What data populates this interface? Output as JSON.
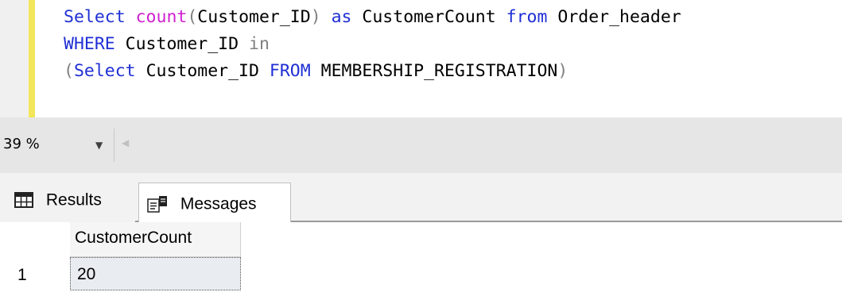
{
  "editor": {
    "lines": [
      [
        {
          "text": "Select ",
          "style": "kw"
        },
        {
          "text": "count",
          "style": "fn"
        },
        {
          "text": "(",
          "style": "gray"
        },
        {
          "text": "Customer_ID",
          "style": "plain"
        },
        {
          "text": ") ",
          "style": "gray"
        },
        {
          "text": "as ",
          "style": "kw"
        },
        {
          "text": "CustomerCount ",
          "style": "plain"
        },
        {
          "text": "from ",
          "style": "kw"
        },
        {
          "text": "Order_header",
          "style": "plain"
        }
      ],
      [
        {
          "text": "WHERE ",
          "style": "kw"
        },
        {
          "text": "Customer_ID ",
          "style": "plain"
        },
        {
          "text": "in",
          "style": "gray"
        }
      ],
      [
        {
          "text": "(",
          "style": "gray"
        },
        {
          "text": "Select ",
          "style": "kw"
        },
        {
          "text": "Customer_ID ",
          "style": "plain"
        },
        {
          "text": "FROM ",
          "style": "kw"
        },
        {
          "text": "MEMBERSHIP_REGISTRATION",
          "style": "plain"
        },
        {
          "text": ")",
          "style": "gray"
        }
      ]
    ]
  },
  "zoom": {
    "value": "39 %",
    "dropdown_icon": "chevron-down-icon",
    "scroll_icon": "scroll-left-icon"
  },
  "tabs": {
    "results": {
      "label": "Results",
      "icon": "grid-icon"
    },
    "messages": {
      "label": "Messages",
      "icon": "messages-icon"
    }
  },
  "grid": {
    "columns": [
      "CustomerCount"
    ],
    "rows": [
      {
        "row_number": "1",
        "cells": [
          "20"
        ]
      }
    ]
  },
  "colors": {
    "keyword": "#1f2fd4",
    "function": "#d020d0",
    "operator": "#808080",
    "change_bar": "#f2e65a",
    "selected_cell": "#e9ecf1"
  }
}
